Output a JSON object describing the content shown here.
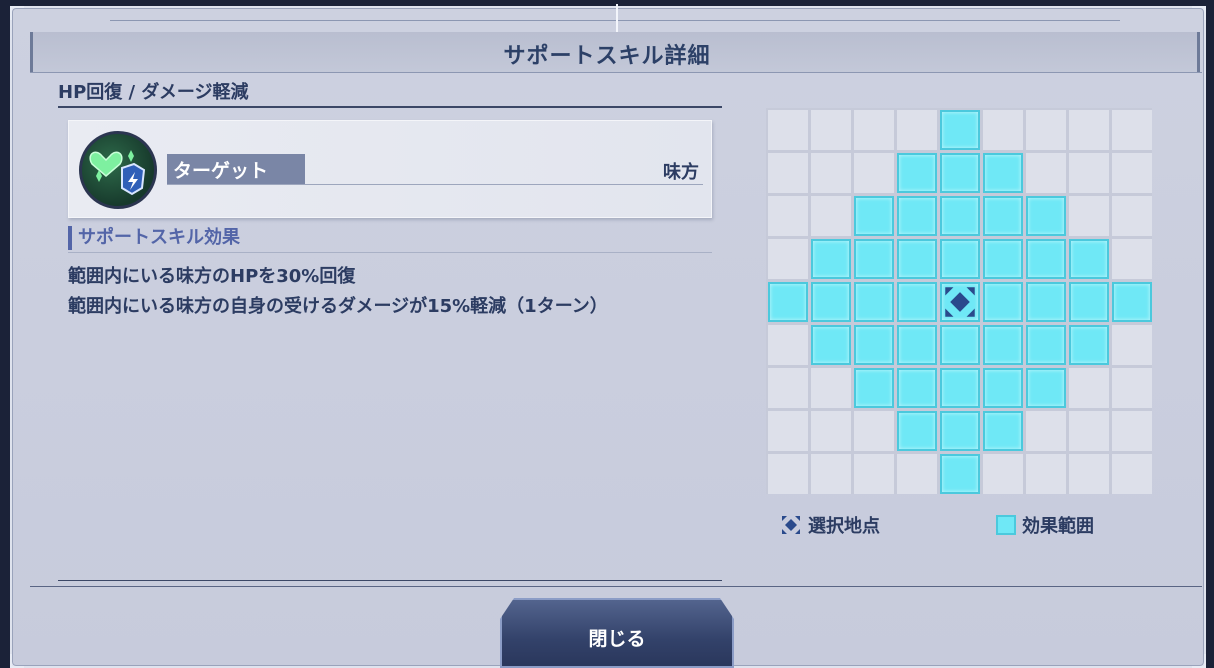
{
  "dialog": {
    "title": "サポートスキル詳細",
    "skill_name": "HP回復 / ダメージ軽減",
    "target": {
      "label": "ターゲット",
      "value": "味方"
    },
    "effect": {
      "heading": "サポートスキル効果",
      "lines": [
        "範囲内にいる味方のHPを30%回復",
        "範囲内にいる味方の自身の受けるダメージが15%軽減（1ターン）"
      ]
    },
    "range_grid": {
      "rows": 9,
      "cols": 9,
      "pattern": [
        "....#....",
        "...###...",
        "..#####..",
        ".#######.",
        "####X####",
        ".#######.",
        "..#####..",
        "...###...",
        "....#...."
      ]
    },
    "legend": {
      "selected_point": "選択地点",
      "effect_range": "効果範囲"
    },
    "close_button": "閉じる"
  },
  "colors": {
    "range_cell": "#6fe8f6",
    "empty_cell": "#dde0ea",
    "marker": "#2a4a8c",
    "text": "#2c3c62",
    "accent": "#5365a8"
  }
}
